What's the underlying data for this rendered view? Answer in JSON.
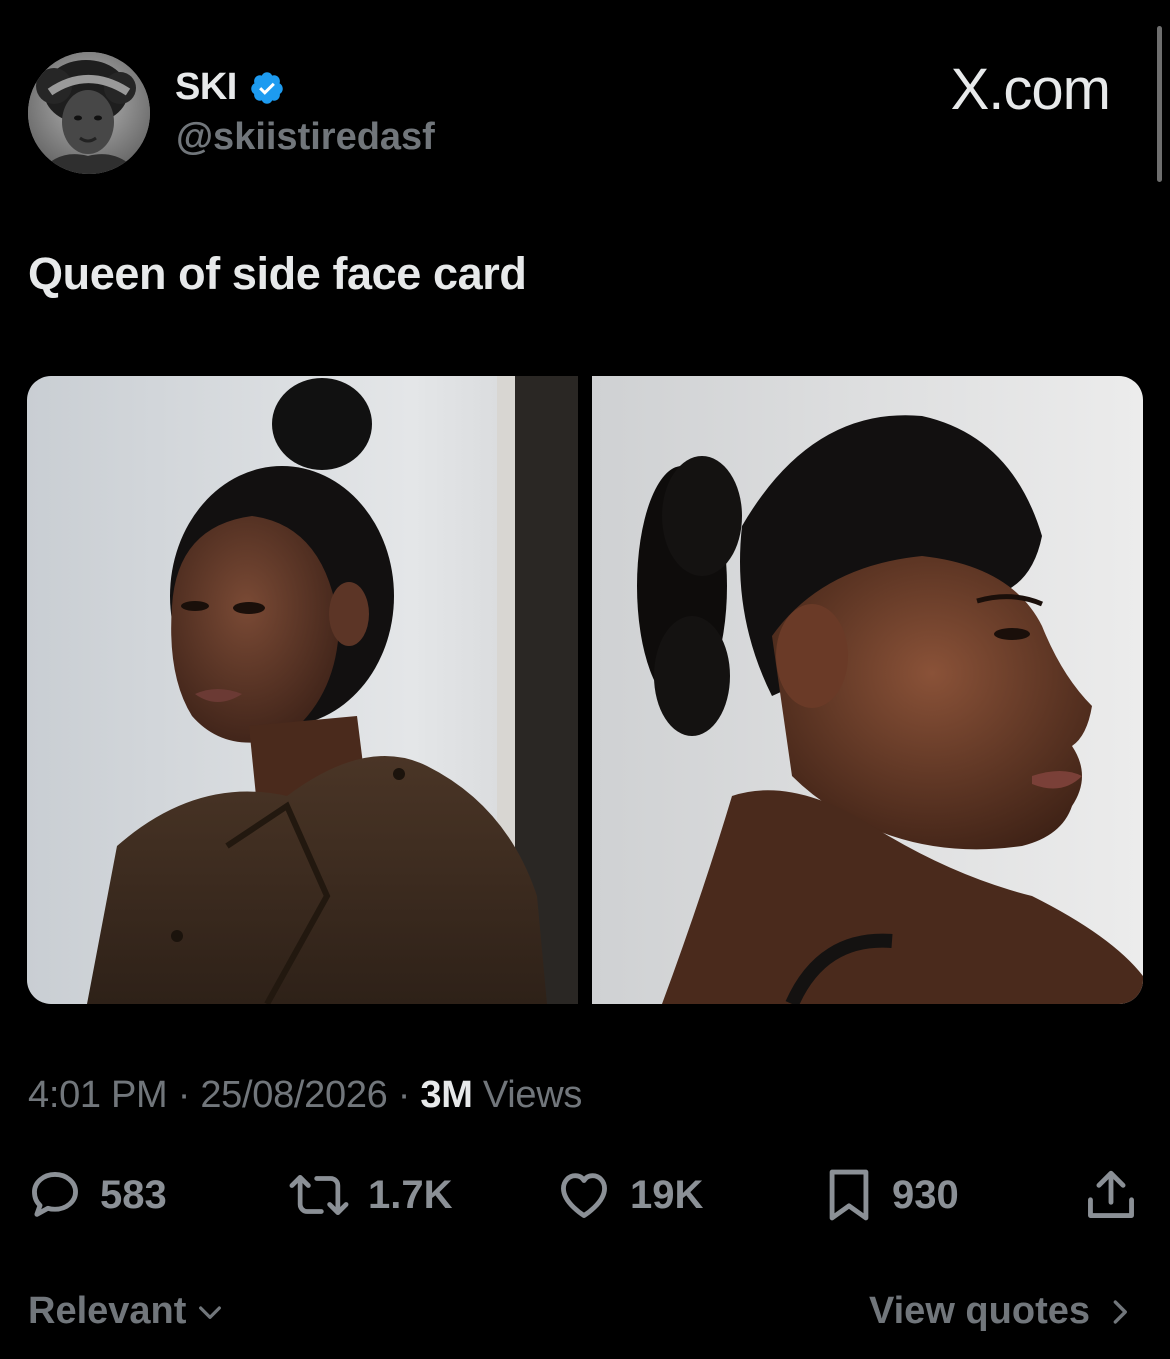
{
  "author": {
    "name": "SKI",
    "handle": "@skiistiredasf",
    "verified": true
  },
  "brand": {
    "label": "X.com"
  },
  "tweet": {
    "text": "Queen of side face card"
  },
  "meta": {
    "time": "4:01 PM",
    "separator": "·",
    "date": "25/08/2026",
    "views_count": "3M",
    "views_label": "Views"
  },
  "actions": {
    "replies": "583",
    "reposts": "1.7K",
    "likes": "19K",
    "bookmarks": "930"
  },
  "footer": {
    "sort_label": "Relevant",
    "quotes_label": "View quotes"
  },
  "colors": {
    "background": "#000000",
    "primary_text": "#e7e9ea",
    "secondary_text": "#71767b",
    "verified": "#1d9bf0"
  },
  "icons": {
    "reply": "speech-bubble-icon",
    "repost": "repost-arrows-icon",
    "like": "heart-icon",
    "bookmark": "bookmark-icon",
    "share": "share-upload-icon",
    "verified": "verified-badge-icon"
  }
}
